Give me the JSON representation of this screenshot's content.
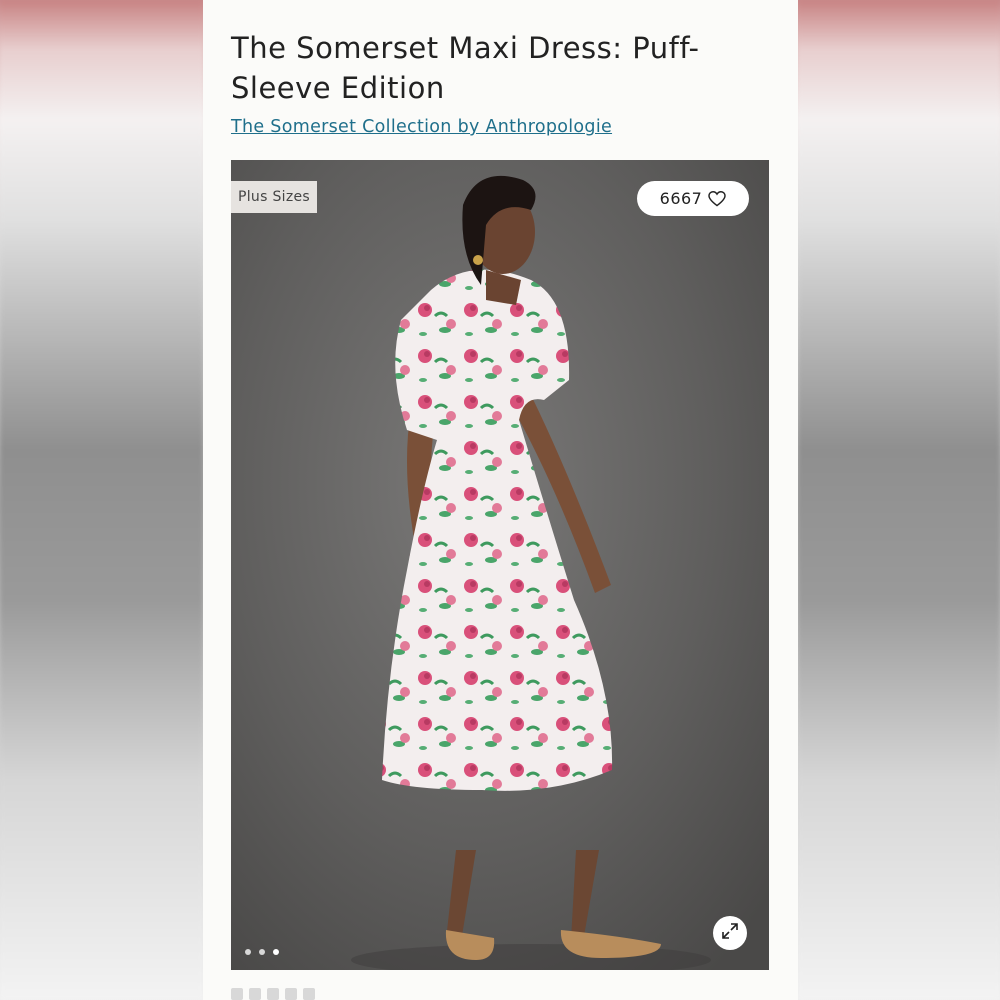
{
  "product": {
    "title": "The Somerset Maxi Dress: Puff-Sleeve Edition",
    "collection_link": "The Somerset Collection by Anthropologie"
  },
  "media": {
    "badge": "Plus Sizes",
    "favorite_count": "6667",
    "icons": {
      "favorite": "heart-icon",
      "expand": "expand-icon"
    },
    "carousel": {
      "total": 3,
      "active": 3
    }
  },
  "colors": {
    "link": "#1f6f8b",
    "title": "#222222",
    "badge_bg": "#e6e3e0",
    "panel_bg": "#fbfbf9"
  }
}
